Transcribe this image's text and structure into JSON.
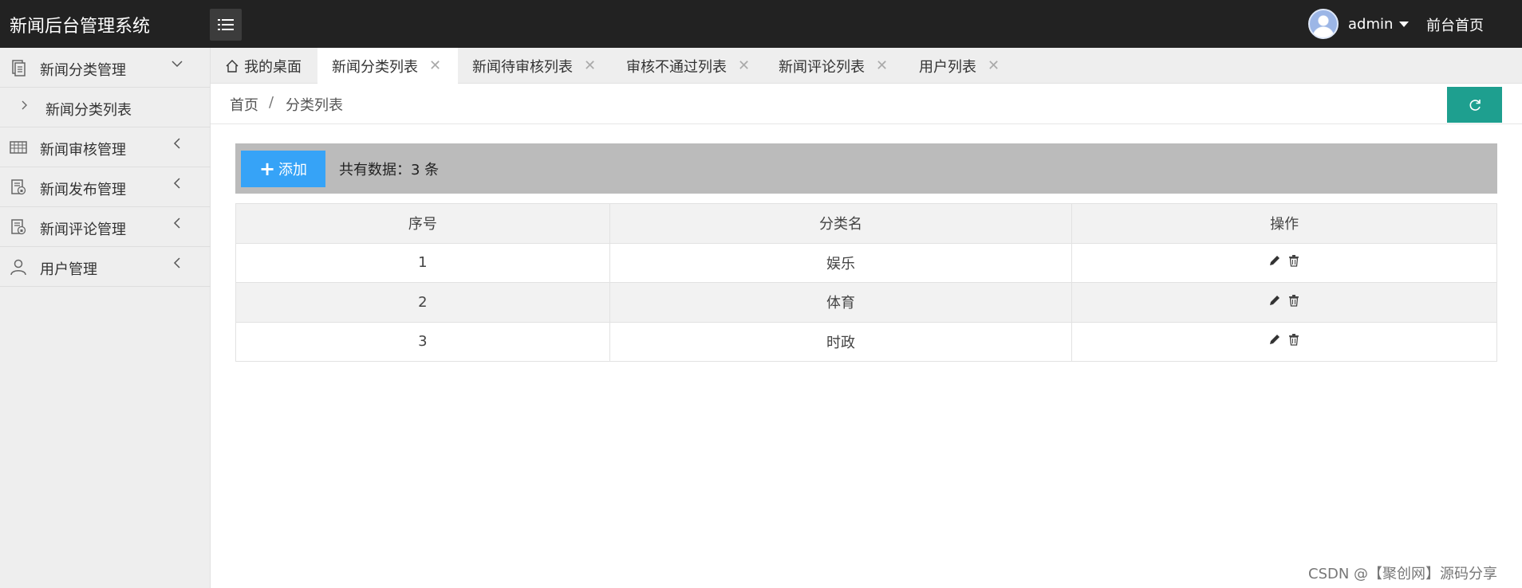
{
  "app": {
    "title": "新闻后台管理系统"
  },
  "header": {
    "user_name": "admin",
    "front_link": "前台首页"
  },
  "sidebar": {
    "items": [
      {
        "label": "新闻分类管理",
        "expanded": true,
        "icon": "document-icon",
        "children": [
          {
            "label": "新闻分类列表"
          }
        ]
      },
      {
        "label": "新闻审核管理",
        "expanded": false,
        "icon": "grid-list-icon"
      },
      {
        "label": "新闻发布管理",
        "expanded": false,
        "icon": "document-lock-icon"
      },
      {
        "label": "新闻评论管理",
        "expanded": false,
        "icon": "document-lock-icon"
      },
      {
        "label": "用户管理",
        "expanded": false,
        "icon": "user-icon"
      }
    ]
  },
  "tabs": [
    {
      "label": "我的桌面",
      "closable": false,
      "active": false
    },
    {
      "label": "新闻分类列表",
      "closable": true,
      "active": true
    },
    {
      "label": "新闻待审核列表",
      "closable": true,
      "active": false
    },
    {
      "label": "审核不通过列表",
      "closable": true,
      "active": false
    },
    {
      "label": "新闻评论列表",
      "closable": true,
      "active": false
    },
    {
      "label": "用户列表",
      "closable": true,
      "active": false
    }
  ],
  "breadcrumb": {
    "home": "首页",
    "separator": "/",
    "current": "分类列表"
  },
  "toolbar": {
    "add_label": "添加",
    "count_text": "共有数据：3 条"
  },
  "table": {
    "columns": [
      "序号",
      "分类名",
      "操作"
    ],
    "rows": [
      {
        "seq": "1",
        "name": "娱乐"
      },
      {
        "seq": "2",
        "name": "体育"
      },
      {
        "seq": "3",
        "name": "时政"
      }
    ]
  },
  "watermark": "CSDN @【聚创网】源码分享",
  "colors": {
    "topbar": "#222222",
    "sidebar": "#eeeeee",
    "add_button": "#36a3f7",
    "refresh_button": "#1e9f8f",
    "toolbar": "#bbbbbb"
  }
}
